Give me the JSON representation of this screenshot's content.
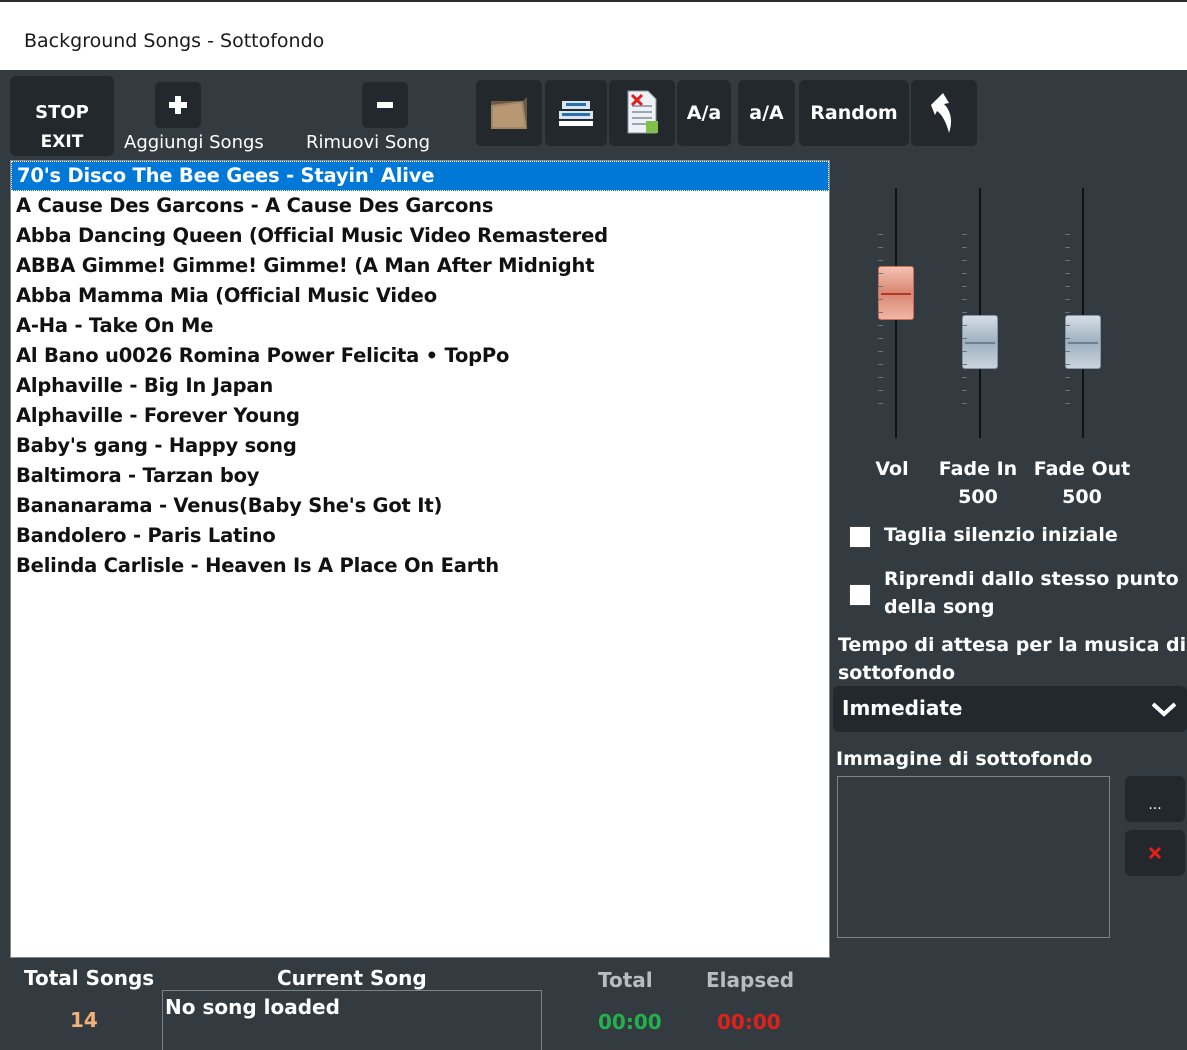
{
  "window": {
    "title": "Background Songs - Sottofondo"
  },
  "toolbar": {
    "stop_line1": "STOP",
    "stop_line2": "EXIT",
    "add_label": "Aggiungi Songs",
    "remove_label": "Rimuovi Song",
    "case_upper_label": "A/a",
    "case_lower_label": "a/A",
    "random_label": "Random",
    "icons": [
      "folder-icon",
      "save-list-icon",
      "delete-file-icon",
      "back-arrow-icon"
    ]
  },
  "songs": [
    "70's Disco The  Bee Gees - Stayin' Alive",
    "A Cause Des Garcons - A Cause Des Garcons",
    "Abba   Dancing Queen (Official Music Video Remastered",
    "ABBA   Gimme! Gimme! Gimme! (A Man After Midnight",
    "Abba   Mamma Mia (Official Music Video",
    "A-Ha - Take On Me",
    "Al Bano u0026 Romina Power   Felicita • TopPo",
    "Alphaville - Big In Japan",
    "Alphaville - Forever Young",
    "Baby's gang - Happy song",
    "Baltimora - Tarzan boy",
    "Bananarama - Venus(Baby She's Got It)",
    "Bandolero - Paris Latino",
    "Belinda Carlisle - Heaven Is A Place On Earth"
  ],
  "selected_song_index": 0,
  "mixer": {
    "vol_label": "Vol",
    "fade_in_label": "Fade In",
    "fade_in_value": "500",
    "fade_out_label": "Fade Out",
    "fade_out_value": "500",
    "vol_level": 0.6,
    "fade_in_level": 0.35,
    "fade_out_level": 0.35,
    "colors": {
      "vol_thumb": "#d98672",
      "fade_thumb": "#9fb0c0"
    }
  },
  "options": {
    "trim_silence_label": "Taglia silenzio iniziale",
    "trim_silence_checked": false,
    "resume_label_line1": "Riprendi dallo stesso punto",
    "resume_label_line2": "della song",
    "resume_checked": false,
    "wait_time_label_line1": "Tempo di attesa per la musica di",
    "wait_time_label_line2": "sottofondo",
    "wait_time_value": "Immediate",
    "background_image_label": "Immagine di sottofondo",
    "browse_label": "...",
    "clear_label": "×"
  },
  "footer": {
    "total_songs_label": "Total Songs",
    "total_songs_value": "14",
    "current_song_label": "Current Song",
    "current_song_value": "No song loaded",
    "total_label": "Total",
    "total_value": "00:00",
    "elapsed_label": "Elapsed",
    "elapsed_value": "00:00",
    "colors": {
      "count": "#f0b27a",
      "total": "#22b14c",
      "elapsed": "#e0201a"
    }
  }
}
